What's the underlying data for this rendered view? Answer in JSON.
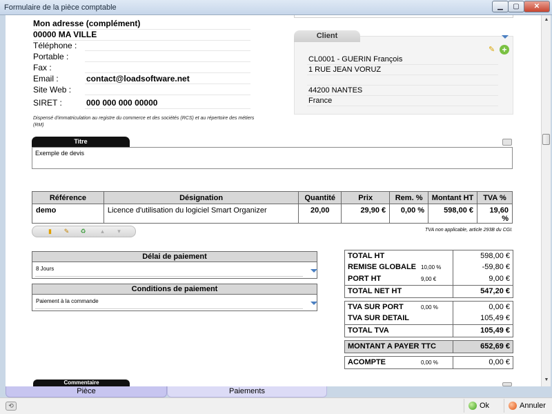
{
  "window": {
    "title": "Formulaire de la pièce comptable",
    "min": "▁",
    "max": "▢",
    "close": "✕"
  },
  "company": {
    "address_line": "Mon adresse (complément)",
    "city_line": "00000 MA VILLE",
    "phone_label": "Téléphone :",
    "mobile_label": "Portable :",
    "fax_label": "Fax :",
    "email_label": "Email :",
    "email_value": "contact@loadsoftware.net",
    "website_label": "Site Web :",
    "siret_label": "SIRET :",
    "siret_value": "000 000 000 00000",
    "legal_note": "Dispensé d'immatriculation au registre du commerce et des sociétés (RCS) et au répertoire des métiers (RM)"
  },
  "client": {
    "tab_label": "Client",
    "lines": [
      "CL0001 - GUERIN François",
      "1 RUE JEAN VORUZ",
      "",
      "44200 NANTES",
      "France"
    ]
  },
  "titre": {
    "tab_label": "Titre",
    "value": "Exemple de devis"
  },
  "items": {
    "headers": [
      "Référence",
      "Désignation",
      "Quantité",
      "Prix",
      "Rem. %",
      "Montant HT",
      "TVA %"
    ],
    "rows": [
      {
        "ref": "demo",
        "designation": "Licence d'utilisation du logiciel Smart Organizer",
        "qty": "20,00",
        "price": "29,90 €",
        "discount": "0,00 %",
        "amount": "598,00 €",
        "vat": "19,60 %"
      }
    ],
    "vat_note": "TVA non applicable, article 293B du CGI."
  },
  "payment": {
    "delay_label": "Délai de paiement",
    "delay_value": "8 Jours",
    "conditions_label": "Conditions de paiement",
    "conditions_value": "Paiement à la commande"
  },
  "totals": {
    "total_ht_label": "TOTAL HT",
    "total_ht": "598,00 €",
    "remise_label": "REMISE GLOBALE",
    "remise_rate": "10,00 %",
    "remise": "-59,80 €",
    "port_label": "PORT HT",
    "port_input": "9,00 €",
    "port": "9,00 €",
    "net_ht_label": "TOTAL NET HT",
    "net_ht": "547,20 €",
    "tva_port_label": "TVA SUR PORT",
    "tva_port_rate": "0,00 %",
    "tva_port": "0,00 €",
    "tva_detail_label": "TVA SUR DETAIL",
    "tva_detail": "105,49 €",
    "total_tva_label": "TOTAL TVA",
    "total_tva": "105,49 €",
    "ttc_label": "MONTANT A PAYER TTC",
    "ttc": "652,69 €",
    "acompte_label": "ACOMPTE",
    "acompte_rate": "0,00 %",
    "acompte": "0,00 €"
  },
  "comment": {
    "tab_label": "Commentaire"
  },
  "tabs": {
    "piece": "Pièce",
    "paiements": "Paiements"
  },
  "status": {
    "ok": "Ok",
    "cancel": "Annuler"
  }
}
